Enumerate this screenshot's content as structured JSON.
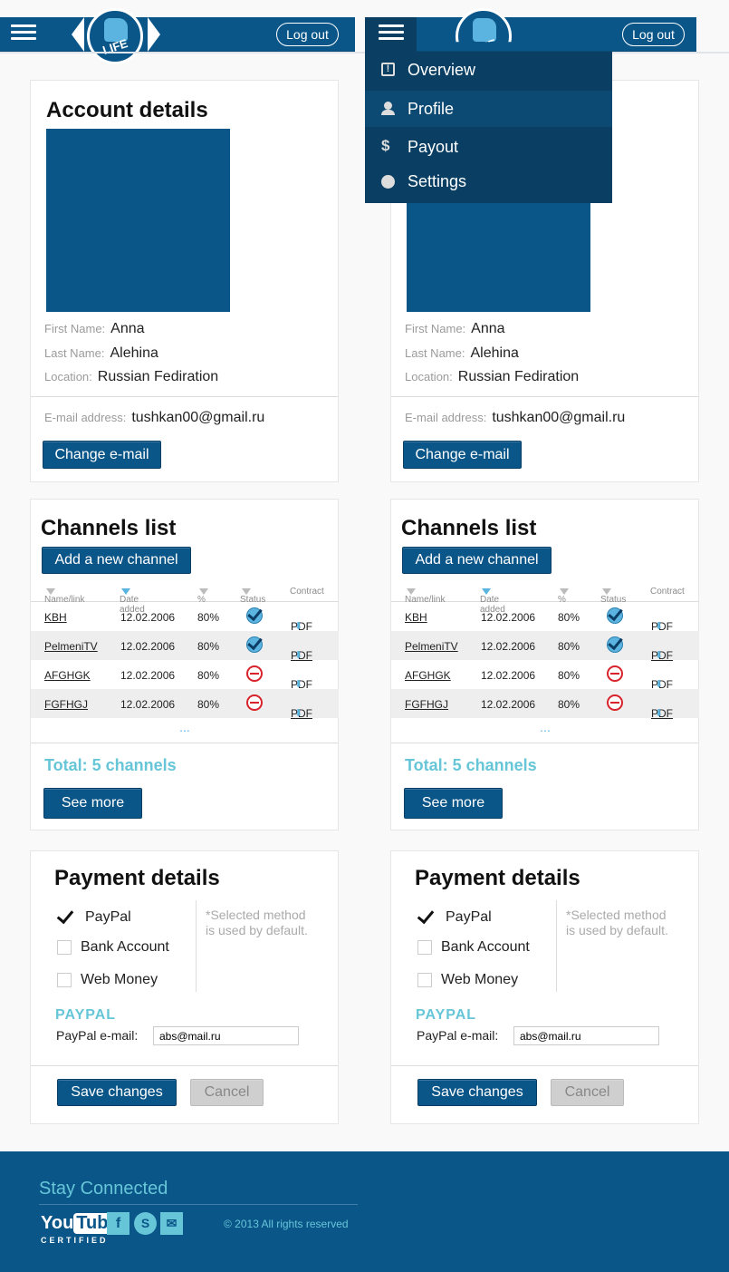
{
  "header": {
    "logout_label": "Log out",
    "logo_text": "LIFE"
  },
  "menu": {
    "items": [
      {
        "label": "Overview",
        "icon": "exclamation-icon"
      },
      {
        "label": "Profile",
        "icon": "user-icon"
      },
      {
        "label": "Payout",
        "icon": "dollar-icon"
      },
      {
        "label": "Settings",
        "icon": "circle-icon"
      }
    ]
  },
  "account": {
    "title": "Account details",
    "first_name_label": "First Name:",
    "first_name": "Anna",
    "last_name_label": "Last Name:",
    "last_name": "Alehina",
    "location_label": "Location:",
    "location": "Russian Fediration",
    "email_label": "E-mail address:",
    "email": "tushkan00@gmail.ru",
    "change_email_label": "Change e-mail"
  },
  "channels": {
    "title": "Channels list",
    "add_label": "Add a new channel",
    "columns": [
      "Name/link",
      "Date added",
      "%",
      "Status",
      "Contract"
    ],
    "rows": [
      {
        "name": "KBH",
        "date": "12.02.2006",
        "percent": "80%",
        "status": "ok",
        "contract": "PDF"
      },
      {
        "name": "PelmeniTV",
        "date": "12.02.2006",
        "percent": "80%",
        "status": "ok",
        "contract": "PDF"
      },
      {
        "name": "AFGHGK",
        "date": "12.02.2006",
        "percent": "80%",
        "status": "blocked",
        "contract": "PDF"
      },
      {
        "name": "FGFHGJ",
        "date": "12.02.2006",
        "percent": "80%",
        "status": "blocked",
        "contract": "PDF"
      }
    ],
    "more": "...",
    "total": "Total: 5 channels",
    "see_more_label": "See more"
  },
  "payment": {
    "title": "Payment details",
    "options": [
      {
        "label": "PayPal",
        "checked": true
      },
      {
        "label": "Bank Account",
        "checked": false
      },
      {
        "label": "Web Money",
        "checked": false
      }
    ],
    "note_line1": "*Selected method",
    "note_line2": "is used by default.",
    "section": "PAYPAL",
    "paypal_email_label": "PayPal e-mail:",
    "paypal_email": "abs@mail.ru",
    "save_label": "Save changes",
    "cancel_label": "Cancel"
  },
  "footer": {
    "stay_connected": "Stay Connected",
    "youtube_1": "You",
    "youtube_2": "Tube",
    "certified": "CERTIFIED",
    "social": [
      "f",
      "S",
      "✉"
    ],
    "copyright": "© 2013 All rights reserved"
  },
  "colors": {
    "brand": "#0b5689",
    "accent": "#5ab4df",
    "teal": "#66c6d8",
    "error": "#d8232a"
  }
}
